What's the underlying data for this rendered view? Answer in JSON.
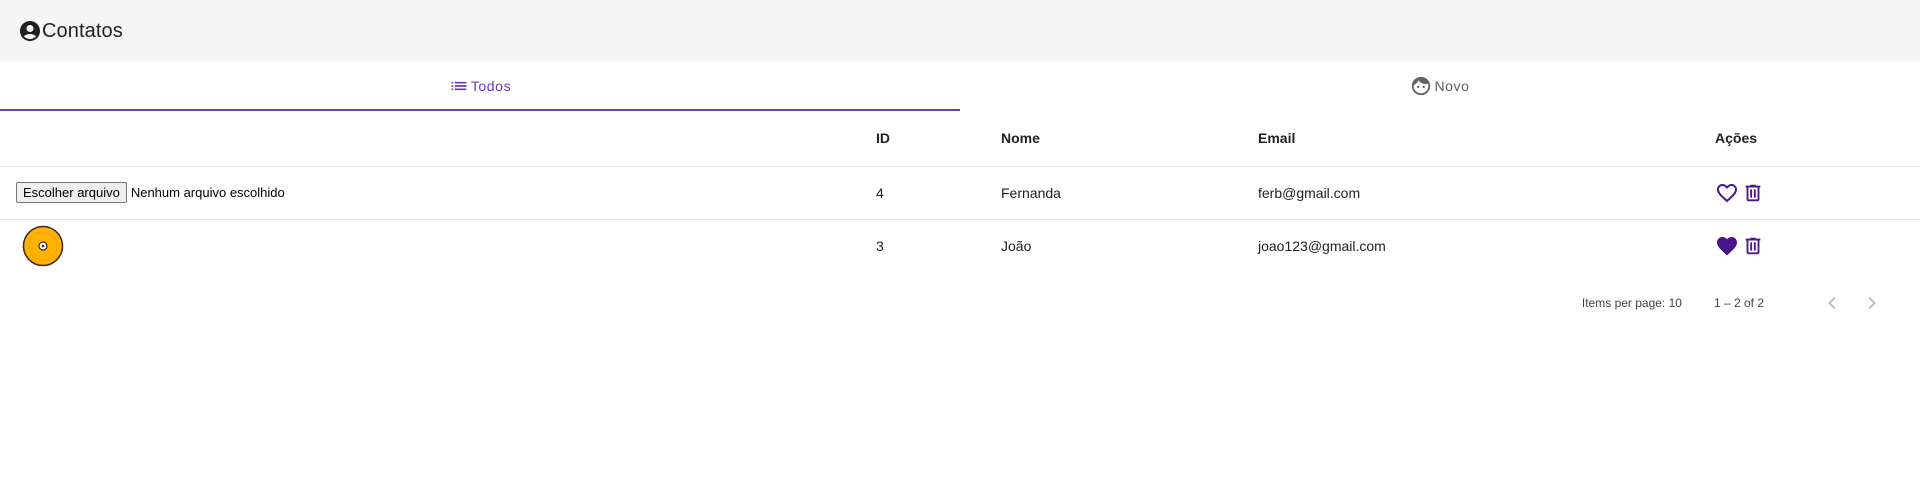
{
  "toolbar": {
    "title": "Contatos",
    "icon": "account-circle-icon"
  },
  "tabs": [
    {
      "label": "Todos",
      "icon": "list-icon",
      "active": true
    },
    {
      "label": "Novo",
      "icon": "face-icon",
      "active": false
    }
  ],
  "table": {
    "headers": {
      "id": "ID",
      "name": "Nome",
      "email": "Email",
      "actions": "Ações"
    },
    "file_input": {
      "button_label": "Escolher arquivo",
      "status": "Nenhum arquivo escolhido"
    },
    "rows": [
      {
        "id": "4",
        "name": "Fernanda",
        "email": "ferb@gmail.com",
        "favorite": false
      },
      {
        "id": "3",
        "name": "João",
        "email": "joao123@gmail.com",
        "favorite": true
      }
    ]
  },
  "paginator": {
    "items_per_page_label": "Items per page: 10",
    "range": "1 – 2 of 2"
  },
  "colors": {
    "accent": "#673ab7",
    "action": "#4a148c",
    "toolbar_bg": "#f5f5f5",
    "avatar": "#ffb300"
  }
}
